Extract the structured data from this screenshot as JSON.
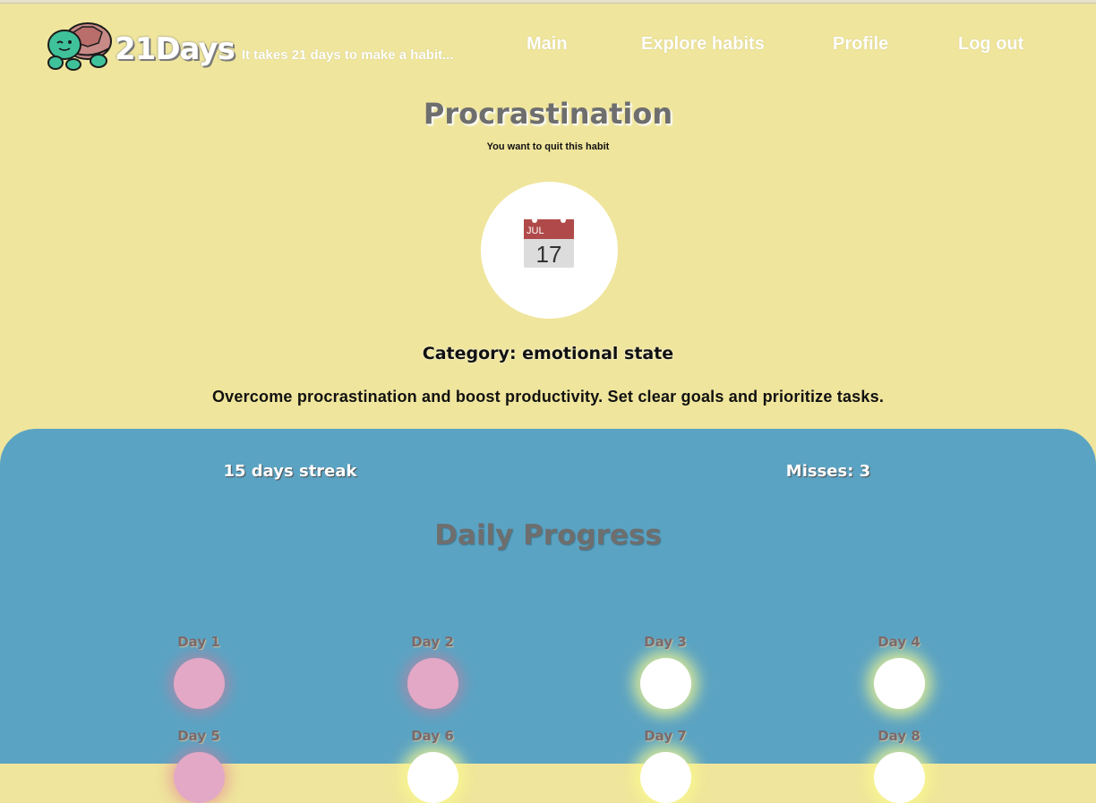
{
  "brand": {
    "name": "21Days",
    "tagline": "It takes 21 days to make a habit..."
  },
  "nav": {
    "items": [
      "Main",
      "Explore habits",
      "Profile",
      "Log out"
    ]
  },
  "habit": {
    "title": "Procrastination",
    "subtitle": "You want to quit this habit",
    "icon": "calendar-icon",
    "icon_month": "JUL",
    "icon_day": "17",
    "category": "Category: emotional state",
    "description": "Overcome procrastination and boost productivity. Set clear goals and prioritize tasks."
  },
  "stats": {
    "streak": "15 days streak",
    "misses": "Misses: 3"
  },
  "progress": {
    "title": "Daily Progress",
    "days": [
      {
        "label": "Day 1",
        "status": "missed"
      },
      {
        "label": "Day 2",
        "status": "missed"
      },
      {
        "label": "Day 3",
        "status": "done"
      },
      {
        "label": "Day 4",
        "status": "done"
      },
      {
        "label": "Day 5",
        "status": "missed"
      },
      {
        "label": "Day 6",
        "status": "done"
      },
      {
        "label": "Day 7",
        "status": "done"
      },
      {
        "label": "Day 8",
        "status": "done"
      }
    ]
  },
  "colors": {
    "background": "#efe59c",
    "panel": "#5ba3c3",
    "missed": "#e2a8c6",
    "done": "#ffffff"
  }
}
